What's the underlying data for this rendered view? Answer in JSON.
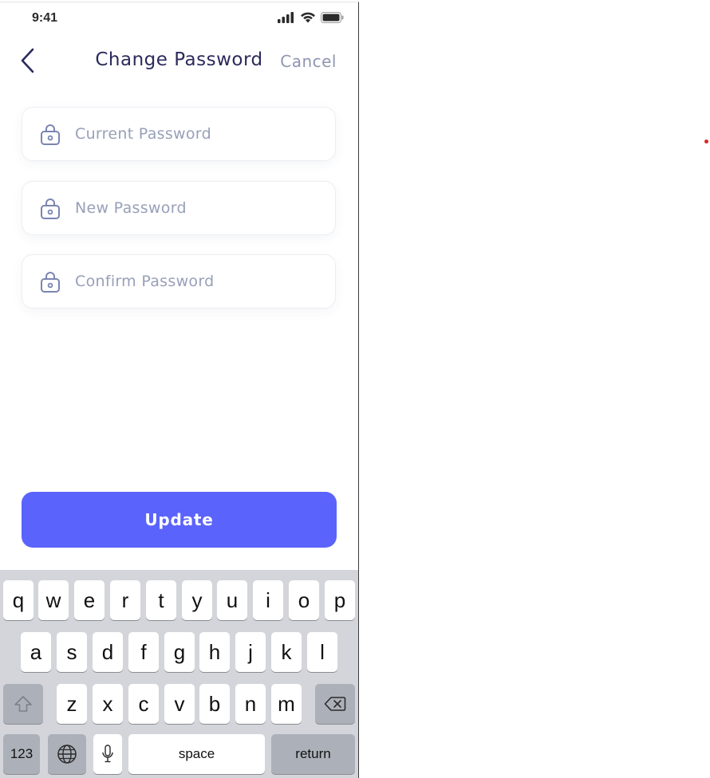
{
  "status_bar": {
    "time": "9:41",
    "icons": [
      "signal-icon",
      "wifi-icon",
      "battery-icon"
    ]
  },
  "nav": {
    "back_icon": "chevron-left-icon",
    "title": "Change Password",
    "cancel_label": "Cancel"
  },
  "form": {
    "fields": [
      {
        "icon": "lock-icon",
        "placeholder": "Current Password",
        "value": ""
      },
      {
        "icon": "lock-icon",
        "placeholder": "New Password",
        "value": ""
      },
      {
        "icon": "lock-icon",
        "placeholder": "Confirm Password",
        "value": ""
      }
    ],
    "update_label": "Update"
  },
  "keyboard": {
    "row1": [
      "q",
      "w",
      "e",
      "r",
      "t",
      "y",
      "u",
      "i",
      "o",
      "p"
    ],
    "row2": [
      "a",
      "s",
      "d",
      "f",
      "g",
      "h",
      "j",
      "k",
      "l"
    ],
    "row3": [
      "z",
      "x",
      "c",
      "v",
      "b",
      "n",
      "m"
    ],
    "shift_icon": "shift-icon",
    "delete_icon": "backspace-icon",
    "numbers_label": "123",
    "globe_icon": "globe-icon",
    "mic_icon": "microphone-icon",
    "space_label": "space",
    "return_label": "return"
  },
  "colors": {
    "accent": "#5a63fb",
    "title": "#2a2b5c",
    "muted": "#98a0b8",
    "keyboard_bg": "#d3d5da"
  }
}
